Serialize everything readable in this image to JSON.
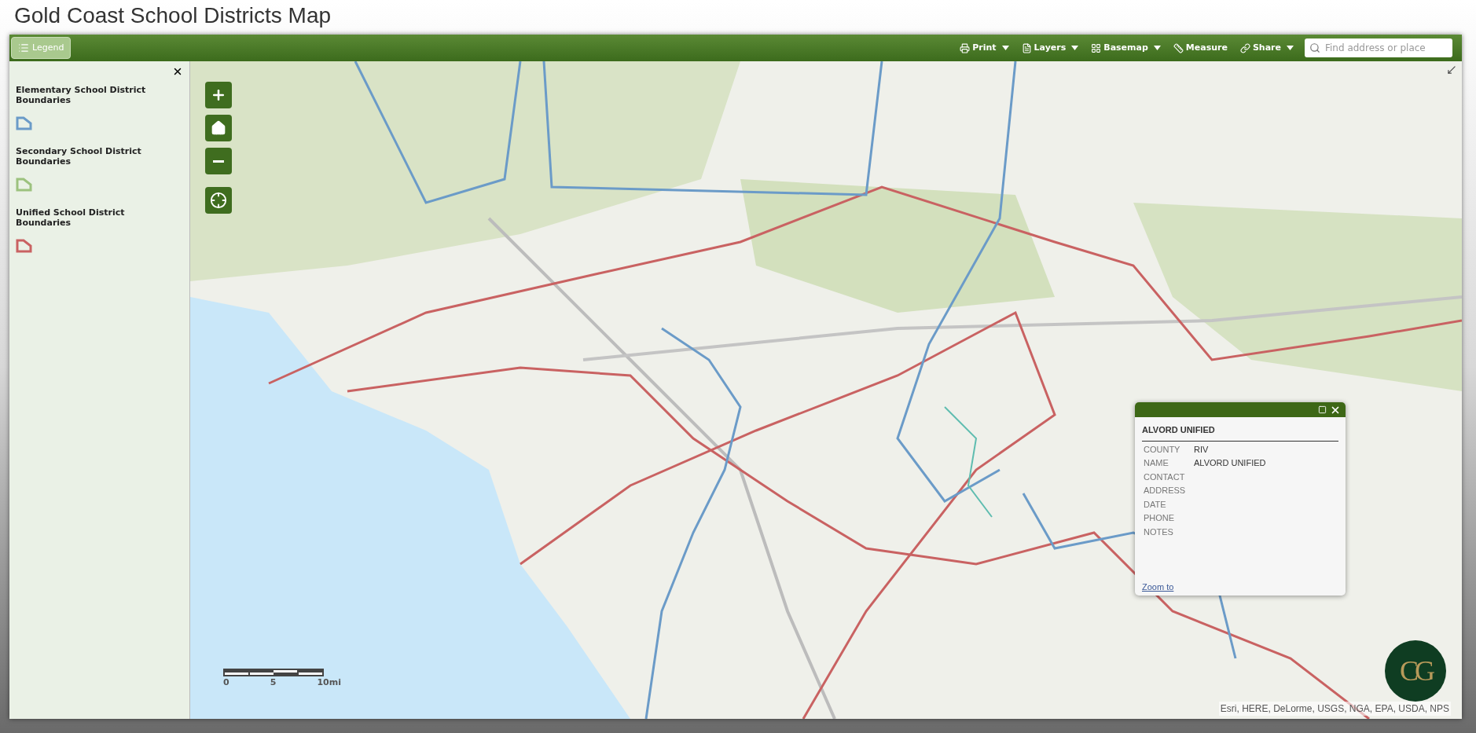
{
  "title": "Gold Coast School Districts Map",
  "toolbar": {
    "legend_button": {
      "label": "Legend",
      "selected": true
    },
    "tools": [
      {
        "label": "Print",
        "kind": "print",
        "dropdown": true
      },
      {
        "label": "Layers",
        "kind": "layers",
        "dropdown": true
      },
      {
        "label": "Basemap",
        "kind": "basemap",
        "dropdown": true
      },
      {
        "label": "Measure",
        "kind": "measure",
        "dropdown": false
      },
      {
        "label": "Share",
        "kind": "share",
        "dropdown": true
      }
    ],
    "search": {
      "placeholder": "Find address or place"
    }
  },
  "legend": {
    "items": [
      {
        "label": "Elementary School District Boundaries",
        "color": "#6b9bc8"
      },
      {
        "label": "Secondary School District Boundaries",
        "color": "#9cc27e"
      },
      {
        "label": "Unified School District Boundaries",
        "color": "#c96262"
      }
    ]
  },
  "map": {
    "scale_bar": {
      "labels": [
        "0",
        "5",
        "10mi"
      ]
    },
    "attribution": "Esri, HERE, DeLorme, USGS, NGA, EPA, USDA, NPS",
    "logo": "CG"
  },
  "popup": {
    "title": "ALVORD UNIFIED",
    "fields": [
      {
        "label": "COUNTY",
        "value": "RIV"
      },
      {
        "label": "NAME",
        "value": "ALVORD UNIFIED"
      },
      {
        "label": "CONTACT"
      },
      {
        "label": "ADDRESS"
      },
      {
        "label": "DATE"
      },
      {
        "label": "PHONE"
      },
      {
        "label": "NOTES"
      }
    ],
    "link": "Zoom to"
  }
}
